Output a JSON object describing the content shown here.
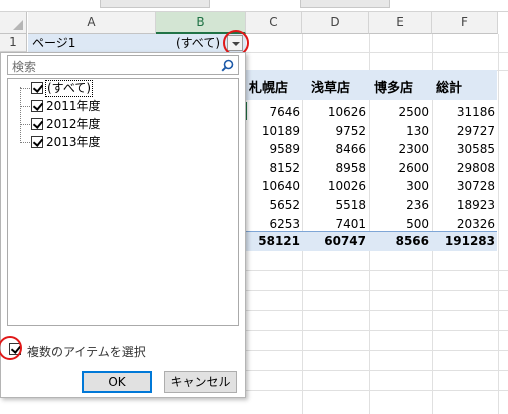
{
  "sheet": {
    "columns": [
      "A",
      "B",
      "C",
      "D",
      "E",
      "F"
    ],
    "rows": [
      "1"
    ],
    "a1": "ページ1",
    "b1": "(すべて)",
    "stores": [
      "札幌店",
      "浅草店",
      "博多店",
      "総計"
    ],
    "data_rows": [
      [
        "7646",
        "10626",
        "2500",
        "31186"
      ],
      [
        "10189",
        "9752",
        "130",
        "29727"
      ],
      [
        "9589",
        "8466",
        "2300",
        "30585"
      ],
      [
        "8152",
        "8958",
        "2600",
        "29808"
      ],
      [
        "10640",
        "10026",
        "300",
        "30728"
      ],
      [
        "5652",
        "5518",
        "236",
        "18923"
      ],
      [
        "6253",
        "7401",
        "500",
        "20326"
      ]
    ],
    "totals": [
      "58121",
      "60747",
      "8566",
      "191283"
    ]
  },
  "filter": {
    "search_placeholder": "検索",
    "search_icon": "search-icon",
    "items": [
      {
        "label": "(すべて)",
        "checked": true
      },
      {
        "label": "2011年度",
        "checked": true
      },
      {
        "label": "2012年度",
        "checked": true
      },
      {
        "label": "2013年度",
        "checked": true
      }
    ],
    "multi_select_label": "複数のアイテムを選択",
    "multi_select_checked": true,
    "ok_label": "OK",
    "cancel_label": "キャンセル"
  },
  "colors": {
    "highlight_band": "#dde8f5",
    "selected_header": "#217346",
    "annotation_ring": "#e01818",
    "ok_border": "#0078d7"
  }
}
